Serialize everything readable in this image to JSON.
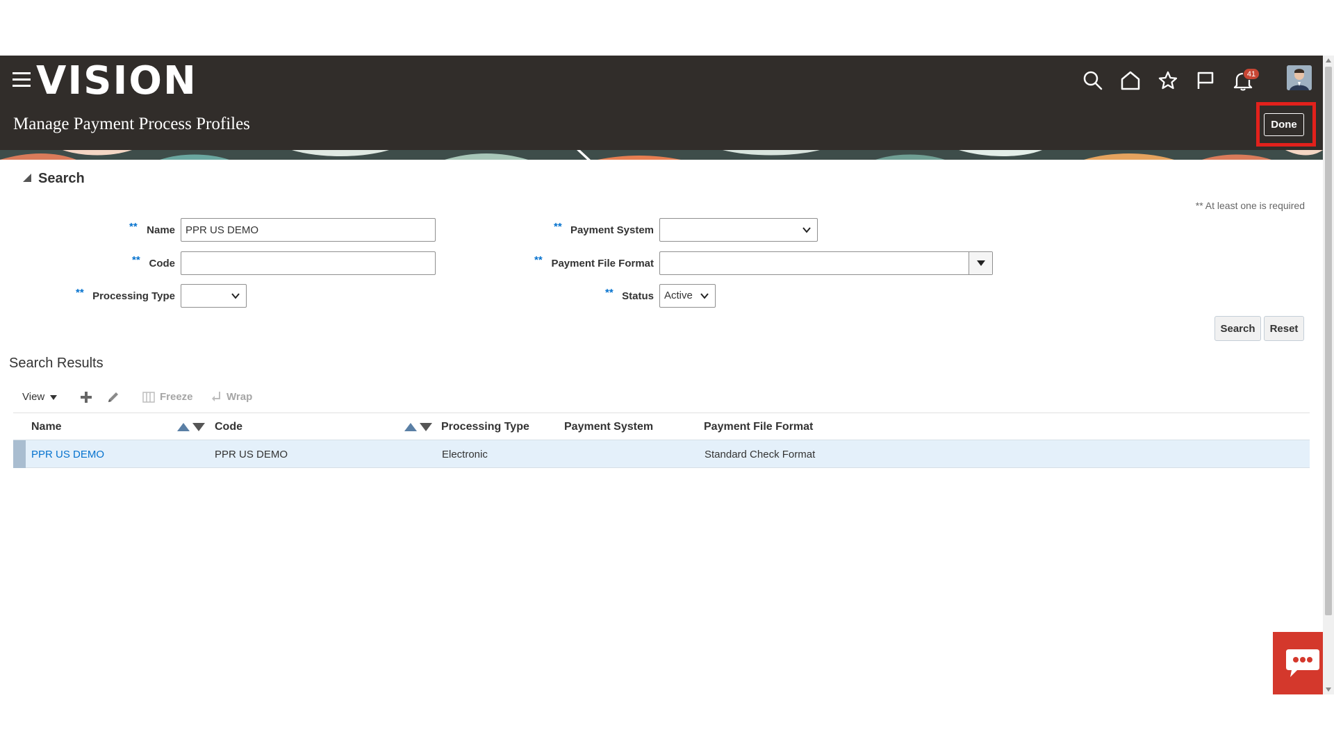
{
  "app": {
    "logo": "VISION",
    "page_title": "Manage Payment Process Profiles",
    "done_label": "Done",
    "notifications_count": "41"
  },
  "colors": {
    "header_bg": "#312d2a",
    "accent_blue": "#0572ce",
    "highlight_red": "#e2211c",
    "chat_red": "#d4382c",
    "selected_row": "#e4f0fa"
  },
  "header_icons": [
    "search-icon",
    "home-icon",
    "favorites-star-icon",
    "flag-icon",
    "notifications-bell-icon"
  ],
  "search": {
    "title": "Search",
    "required_note": "** At least one is required",
    "required_marker": "**",
    "fields": {
      "name": {
        "label": "Name",
        "value": "PPR US DEMO"
      },
      "code": {
        "label": "Code",
        "value": ""
      },
      "processing_type": {
        "label": "Processing Type",
        "value": ""
      },
      "payment_system": {
        "label": "Payment System",
        "value": ""
      },
      "payment_file_format": {
        "label": "Payment File Format",
        "value": ""
      },
      "status": {
        "label": "Status",
        "value": "Active"
      }
    },
    "search_button": "Search",
    "reset_button": "Reset"
  },
  "results": {
    "title": "Search Results",
    "toolbar": {
      "view_label": "View",
      "freeze_label": "Freeze",
      "wrap_label": "Wrap"
    },
    "columns": [
      "Name",
      "Code",
      "Processing Type",
      "Payment System",
      "Payment File Format"
    ],
    "rows": [
      {
        "name": "PPR US DEMO",
        "code": "PPR US DEMO",
        "processing_type": "Electronic",
        "payment_system": "",
        "payment_file_format": "Standard Check Format"
      }
    ]
  }
}
